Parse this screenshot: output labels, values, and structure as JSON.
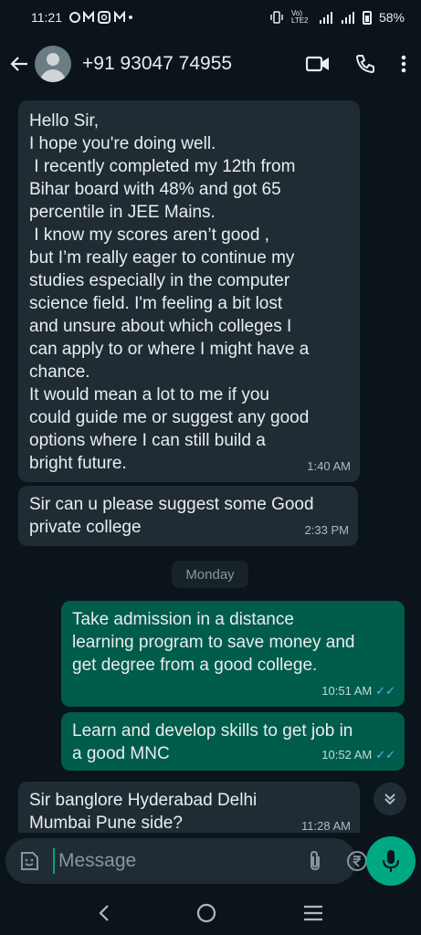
{
  "status_bar": {
    "time": "11:21",
    "battery": "58%",
    "network_label": "Vo) LTE2"
  },
  "header": {
    "contact": "+91 93047 74955"
  },
  "messages": [
    {
      "direction": "in",
      "text": "Hello Sir,\nI hope you're doing well.\n I recently completed my 12th from\nBihar board with 48% and got 65\npercentile in JEE Mains.\n I know my scores aren’t good ,\nbut I’m really eager to continue my\nstudies especially in the computer\nscience field. I'm feeling a bit lost\nand unsure about which colleges I\ncan apply to or where I might have a\nchance.\nIt would mean a lot to me if you\ncould guide me or suggest any good\noptions where I can still build a\nbright future.",
      "time": "1:40 AM"
    },
    {
      "direction": "in",
      "text": "Sir can u please suggest some Good\nprivate college",
      "time": "2:33 PM"
    },
    {
      "direction": "out",
      "text": "Take admission in a distance\nlearning program to save money and\nget degree from a good college.",
      "time": "10:51 AM"
    },
    {
      "direction": "out",
      "text": "Learn and develop skills to get job in\na good MNC",
      "time": "10:52 AM"
    },
    {
      "direction": "in",
      "text": "Sir banglore Hyderabad Delhi\nMumbai Pune side?",
      "time": "11:28 AM"
    }
  ],
  "date_separator": "Monday",
  "composer": {
    "placeholder": "Message"
  },
  "colors": {
    "accent": "#00a884",
    "outgoing_bubble": "#005c4b",
    "incoming_bubble": "#202c33",
    "read_ticks": "#53bdeb"
  }
}
